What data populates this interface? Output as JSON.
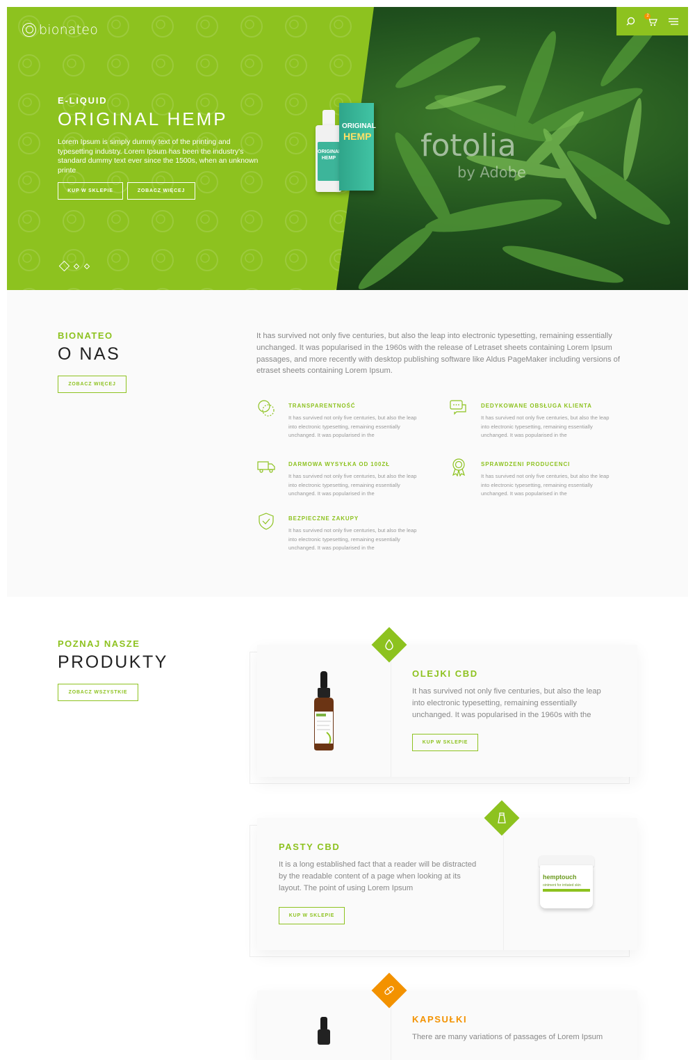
{
  "header": {
    "logo_text": "bionateo",
    "cart_count": "2",
    "icons": [
      "search-icon",
      "cart-icon",
      "menu-icon"
    ]
  },
  "hero": {
    "kicker": "E-LIQUID",
    "title": "ORIGINAL HEMP",
    "text": "Lorem Ipsum is simply dummy text of the printing and typesetting industry. Lorem Ipsum has been the industry's standard dummy text ever since the 1500s, when an unknown printe",
    "btn_shop": "KUP W SKLEPIE",
    "btn_more": "ZOBACZ WIĘCEJ",
    "watermark": "fotolia",
    "watermark_sub": "by Adobe",
    "box_line1": "ORIGINAL",
    "box_line2": "HEMP",
    "bottle_label": "ORIGINAL HEMP",
    "slides": 3
  },
  "about": {
    "kicker": "BIONATEO",
    "title": "O NAS",
    "btn": "ZOBACZ WIĘCEJ",
    "intro": "It has survived not only five centuries, but also the leap into electronic typesetting, remaining essentially unchanged. It was popularised in the 1960s with the release of Letraset sheets containing Lorem Ipsum passages, and more recently with desktop publishing software like Aldus PageMaker including versions of etraset sheets containing Lorem Ipsum.",
    "features": [
      {
        "title": "TRANSPARENTNOŚĆ",
        "text": "It has survived not only five centuries, but also the leap into electronic typesetting, remaining essentially unchanged. It was popularised in the",
        "icon": "transparency-icon"
      },
      {
        "title": "DEDYKOWANE OBSŁUGA KLIENTA",
        "text": "It has survived not only five centuries, but also the leap into electronic typesetting, remaining essentially unchanged. It was popularised in the",
        "icon": "chat-icon"
      },
      {
        "title": "DARMOWA WYSYŁKA OD 100ZŁ",
        "text": "It has survived not only five centuries, but also the leap into electronic typesetting, remaining essentially unchanged. It was popularised in the",
        "icon": "truck-icon"
      },
      {
        "title": "SPRAWDZENI PRODUCENCI",
        "text": "It has survived not only five centuries, but also the leap into electronic typesetting, remaining essentially unchanged. It was popularised in the",
        "icon": "award-icon"
      },
      {
        "title": "BEZPIECZNE ZAKUPY",
        "text": "It has survived not only five centuries, but also the leap into electronic typesetting, remaining essentially unchanged. It was popularised in the",
        "icon": "shield-icon"
      }
    ]
  },
  "products": {
    "kicker": "POZNAJ NASZE",
    "title": "PRODUKTY",
    "btn": "ZOBACZ WSZYSTKIE",
    "items": [
      {
        "name": "OLEJKI CBD",
        "text": "It has survived not only five centuries, but also the leap into electronic typesetting, remaining essentially unchanged. It was popularised in the 1960s with the",
        "btn": "KUP W SKLEPIE",
        "icon": "drop-icon",
        "color": "#8dc21f",
        "label": "hemptouch"
      },
      {
        "name": "PASTY CBD",
        "text": "It is a long established fact that a reader will be distracted by the readable content of a page when looking at its layout. The point of using Lorem Ipsum",
        "btn": "KUP W SKLEPIE",
        "icon": "tube-icon",
        "color": "#8dc21f",
        "label": "hemptouch",
        "label_sub": "ointment for irritated skin"
      },
      {
        "name": "KAPSUŁKI",
        "text": "There are many variations of passages of Lorem Ipsum",
        "icon": "capsule-icon",
        "color": "#f39200"
      }
    ]
  },
  "colors": {
    "accent": "#8dc21f",
    "orange": "#f39200"
  }
}
